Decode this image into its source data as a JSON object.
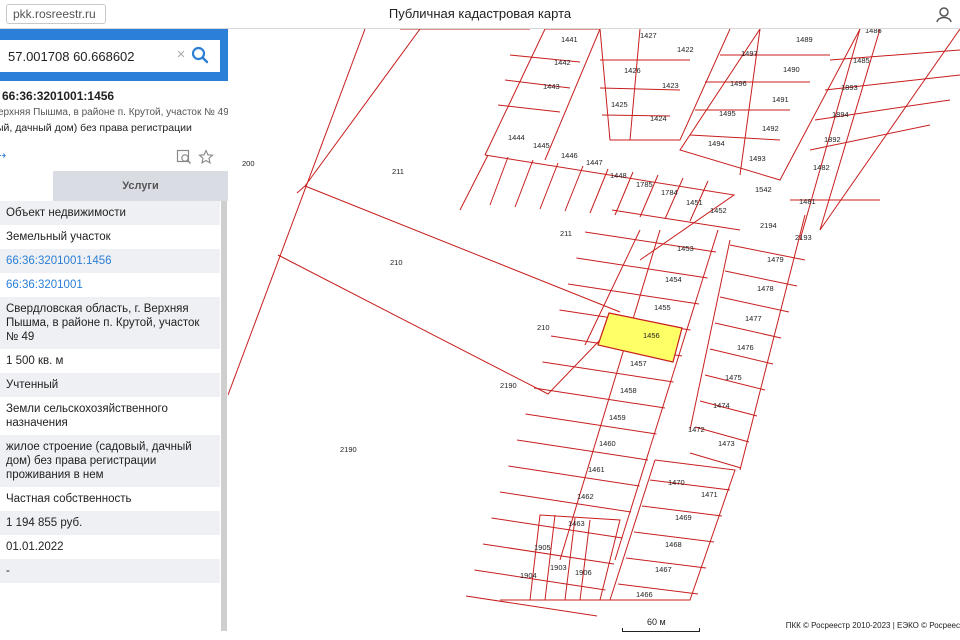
{
  "browser": {
    "url": "pkk.rosreestr.ru",
    "title": "Публичная кадастровая карта"
  },
  "search": {
    "value": "57.001708 60.668602",
    "clear_glyph": "×",
    "collapse_glyph": "‹"
  },
  "object": {
    "cadnum": "66:36:3201001:1456",
    "address_short": "ерхняя Пышма, в районе п. Крутой, участок № 49",
    "use_short": "ый, дачный дом) без права регистрации",
    "arrow": "⇢"
  },
  "tabs": {
    "services": "Услуги"
  },
  "rows": [
    {
      "text": "Объект недвижимости",
      "alt": true,
      "link": false
    },
    {
      "text": "Земельный участок",
      "alt": false,
      "link": false
    },
    {
      "text": "66:36:3201001:1456",
      "alt": true,
      "link": true
    },
    {
      "text": "66:36:3201001",
      "alt": false,
      "link": true
    },
    {
      "text": "Свердловская область, г. Верхняя Пышма, в районе п. Крутой, участок № 49",
      "alt": true,
      "link": false
    },
    {
      "text": "1 500 кв. м",
      "alt": false,
      "link": false
    },
    {
      "text": "Учтенный",
      "alt": true,
      "link": false
    },
    {
      "text": "Земли сельскохозяйственного назначения",
      "alt": false,
      "link": false
    },
    {
      "text": "жилое строение (садовый, дачный дом) без права регистрации проживания в нем",
      "alt": true,
      "link": false
    },
    {
      "text": "Частная собственность",
      "alt": false,
      "link": false
    },
    {
      "text": "1 194 855 руб.",
      "alt": true,
      "link": false
    },
    {
      "text": "01.01.2022",
      "alt": false,
      "link": false
    },
    {
      "text": "-",
      "alt": true,
      "link": false
    }
  ],
  "map": {
    "parcel_labels": [
      "200",
      "211",
      "211",
      "210",
      "210",
      "2190",
      "2190",
      "1441",
      "1442",
      "1443",
      "1427",
      "1422",
      "1426",
      "1423",
      "1425",
      "1424",
      "1497",
      "1489",
      "1486",
      "1490",
      "1485",
      "1496",
      "1491",
      "1893",
      "1495",
      "1492",
      "1894",
      "1494",
      "1493",
      "1892",
      "1444",
      "1445",
      "1446",
      "1447",
      "1448",
      "1785",
      "1784",
      "1451",
      "1452",
      "1542",
      "1482",
      "1481",
      "2194",
      "2193",
      "1453",
      "1479",
      "1454",
      "1478",
      "1455",
      "1477",
      "1456",
      "1457",
      "1476",
      "1458",
      "1475",
      "1459",
      "1474",
      "1472",
      "1473",
      "1460",
      "1461",
      "1470",
      "1471",
      "1462",
      "1469",
      "1463",
      "1468",
      "1905",
      "1467",
      "1904",
      "1903",
      "1906",
      "1466"
    ],
    "selected": "1456",
    "scale": "60 м",
    "copyright": "ПКК © Росреестр 2010-2023 | ЕЭКО © Росреес",
    "line_color": "#c81e1e",
    "selected_fill": "#ffff66"
  }
}
